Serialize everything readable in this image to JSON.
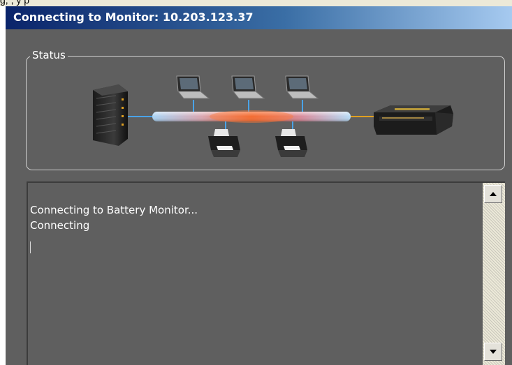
{
  "window": {
    "title": "Connecting to Monitor: 10.203.123.37"
  },
  "top_strip": {
    "partial_text": "g, , y p"
  },
  "status": {
    "legend": "Status",
    "diagram": {
      "icons": [
        "server-rack-icon",
        "laptop-icon",
        "laptop-icon",
        "laptop-icon",
        "printer-icon",
        "printer-icon",
        "battery-monitor-device-icon"
      ]
    }
  },
  "log": {
    "lines": [
      "Connecting to Battery Monitor...",
      "Connecting"
    ]
  },
  "scrollbar": {
    "up_icon": "scroll-up-arrow-icon",
    "down_icon": "scroll-down-arrow-icon"
  },
  "colors": {
    "window_background": "#5f5f5f",
    "title_gradient_start": "#0a246a",
    "title_gradient_end": "#a6caf0",
    "link_glow": "#e05a2a",
    "link_cool": "#8fc4f0"
  }
}
